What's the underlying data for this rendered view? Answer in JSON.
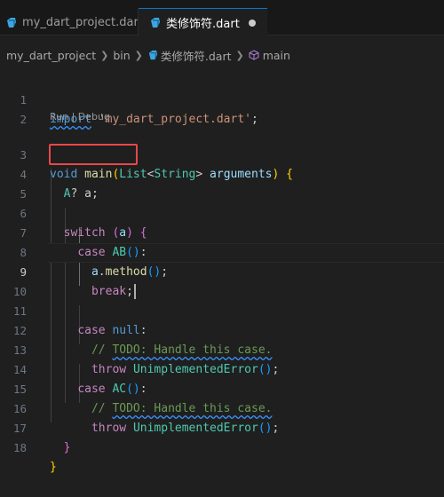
{
  "tabs": [
    {
      "label": "my_dart_project.dart",
      "active": false
    },
    {
      "label": "类修饰符.dart",
      "active": true,
      "modified": true
    }
  ],
  "breadcrumb": {
    "items": [
      "my_dart_project",
      "bin",
      "类修饰符.dart",
      "main"
    ]
  },
  "codelens": "Run | Debug",
  "colors": {
    "keyword": "#569cd6",
    "control": "#c586c0",
    "string": "#ce9178",
    "type": "#4ec9b0",
    "function": "#dcdcaa",
    "variable": "#9cdcfe",
    "comment": "#6a9955",
    "highlight_box": "#e8484a"
  },
  "editor": {
    "current_line": 9,
    "line_numbers": [
      "1",
      "2",
      "3",
      "4",
      "5",
      "6",
      "7",
      "8",
      "9",
      "10",
      "11",
      "12",
      "13",
      "14",
      "15",
      "16",
      "17",
      "18"
    ],
    "lines": {
      "l1": {
        "kw": "import",
        "str": "'my_dart_project.dart'",
        "end": ";"
      },
      "l3": {
        "kw": "void",
        "fn": "main",
        "type1": "List",
        "type2": "String",
        "param": "arguments"
      },
      "l4": {
        "type": "A",
        "rest": "? a;"
      },
      "l6": {
        "kw": "switch",
        "var": "a"
      },
      "l7": {
        "kw": "case",
        "type": "AB"
      },
      "l8": {
        "var": "a",
        "fn": "method"
      },
      "l9": {
        "kw": "break"
      },
      "l11": {
        "kw": "case",
        "kw2": "null"
      },
      "l12": {
        "comment_prefix": "// ",
        "todo": "TODO: Handle this case."
      },
      "l13": {
        "kw": "throw",
        "type": "UnimplementedError"
      },
      "l14": {
        "kw": "case",
        "type": "AC"
      },
      "l15": {
        "comment_prefix": "// ",
        "todo": "TODO: Handle this case."
      },
      "l16": {
        "kw": "throw",
        "type": "UnimplementedError"
      }
    }
  }
}
